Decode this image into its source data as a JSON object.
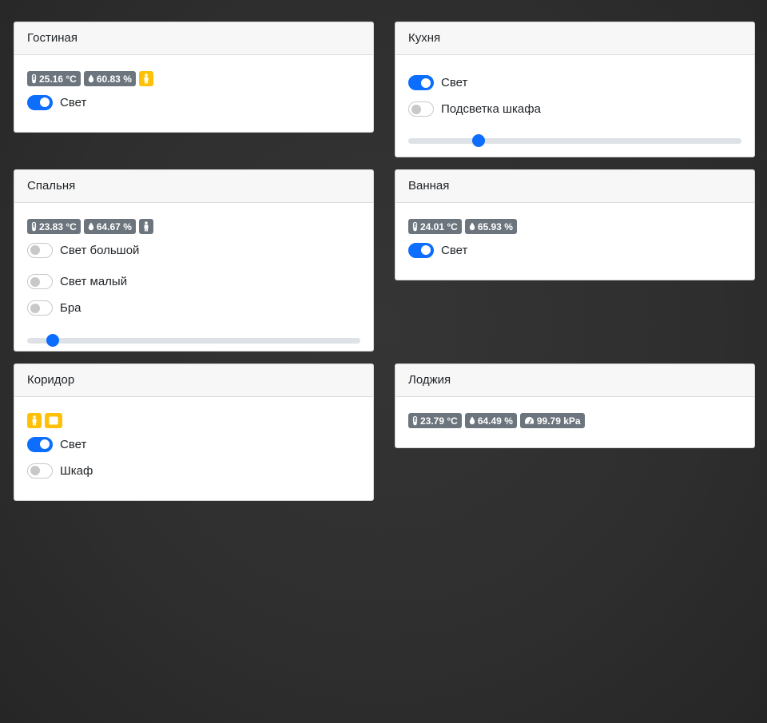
{
  "rooms": {
    "living": {
      "title": "Гостиная",
      "temperature": "25.16 °C",
      "humidity": "60.83 %",
      "motion_icon": "person-icon",
      "light_label": "Свет",
      "light_on": true
    },
    "kitchen": {
      "title": "Кухня",
      "light_label": "Свет",
      "light_on": true,
      "cabinet_light_label": "Подсветка шкафа",
      "cabinet_light_on": false,
      "dimmer_level": 0.2
    },
    "bedroom": {
      "title": "Спальня",
      "temperature": "23.83 °C",
      "humidity": "64.67 %",
      "motion_icon": "person-icon",
      "big_light_label": "Свет большой",
      "big_light_on": false,
      "small_light_label": "Свет малый",
      "small_light_on": false,
      "sconce_label": "Бра",
      "sconce_on": false,
      "dimmer_level": 0.06
    },
    "bathroom": {
      "title": "Ванная",
      "temperature": "24.01 °C",
      "humidity": "65.93 %",
      "light_label": "Свет",
      "light_on": true
    },
    "corridor": {
      "title": "Коридор",
      "motion_icon": "person-icon",
      "door_icon": "square-icon",
      "light_label": "Свет",
      "light_on": true,
      "wardrobe_label": "Шкаф",
      "wardrobe_on": false
    },
    "loggia": {
      "title": "Лоджия",
      "temperature": "23.79 °C",
      "humidity": "64.49 %",
      "pressure": "99.79 kPa"
    }
  },
  "colors": {
    "accent": "#0d6efd",
    "badge_secondary": "#6c757d",
    "badge_warning": "#ffc107",
    "background": "#2e2e2e"
  }
}
